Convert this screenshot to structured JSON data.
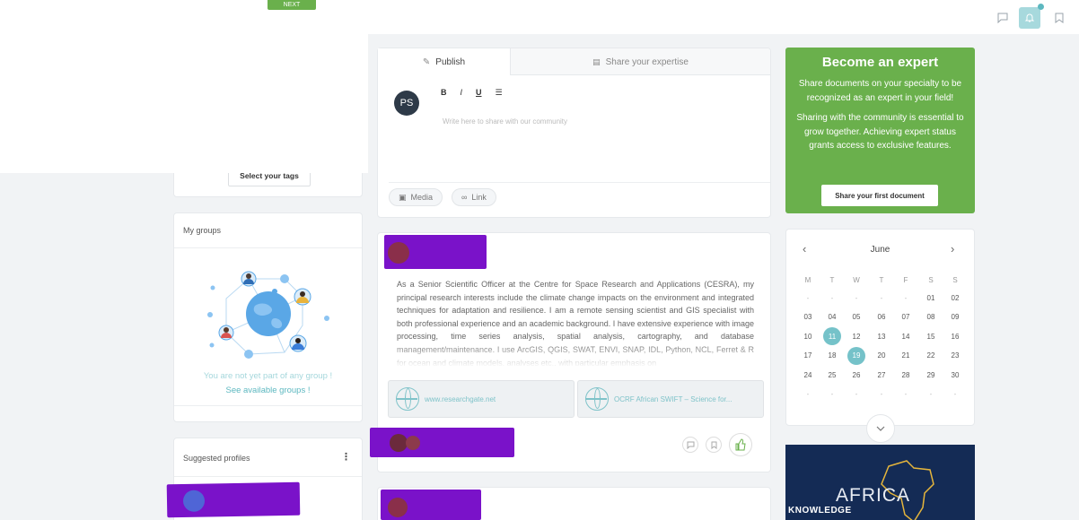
{
  "topbar": {
    "next_label": "NEXT"
  },
  "tags": {
    "button_label": "Select your tags"
  },
  "groups": {
    "title": "My groups",
    "empty_text": "You are not yet part of any group !",
    "link_text": "See available groups !"
  },
  "suggested": {
    "title": "Suggested profiles"
  },
  "composer": {
    "tab_publish": "Publish",
    "tab_expertise": "Share your expertise",
    "avatar_initials": "PS",
    "toolbar": {
      "bold": "B",
      "italic": "I",
      "underline": "U"
    },
    "placeholder": "Write here to share with our community",
    "media_label": "Media",
    "link_label": "Link"
  },
  "post": {
    "body": "As a Senior Scientific Officer at the Centre for Space Research and Applications (CESRA), my principal research interests include the climate change impacts on the environment and integrated techniques for adaptation and resilience. I am a remote sensing scientist and GIS specialist with both professional experience and an academic background. I have extensive experience with image processing, time series analysis, spatial analysis, cartography, and database management/maintenance. I use ArcGIS, QGIS, SWAT, ENVI, SNAP, IDL, Python, NCL, Ferret & R for ocean and climate models, analyses etc., with particular emphasis on",
    "links": [
      {
        "text": "www.researchgate.net"
      },
      {
        "text": "OCRF African SWIFT – Science for..."
      }
    ]
  },
  "expert": {
    "title": "Become an expert",
    "text1": "Share documents on your specialty to be recognized as an expert in your field!",
    "text2": "Sharing with the community is essential to grow together. Achieving expert status grants access to exclusive features.",
    "button": "Share your first document"
  },
  "calendar": {
    "month": "June",
    "weekdays": [
      "M",
      "T",
      "W",
      "T",
      "F",
      "S",
      "S"
    ],
    "rows": [
      [
        "-",
        "-",
        "-",
        "-",
        "-",
        "01",
        "02"
      ],
      [
        "03",
        "04",
        "05",
        "06",
        "07",
        "08",
        "09"
      ],
      [
        "10",
        "11",
        "12",
        "13",
        "14",
        "15",
        "16"
      ],
      [
        "17",
        "18",
        "19",
        "20",
        "21",
        "22",
        "23"
      ],
      [
        "24",
        "25",
        "26",
        "27",
        "28",
        "29",
        "30"
      ],
      [
        "-",
        "-",
        "-",
        "-",
        "-",
        "-",
        "-"
      ]
    ],
    "highlighted": [
      "11",
      "19"
    ]
  },
  "promo": {
    "line1": "AFRICA",
    "line2": "KNOWLEDGE"
  },
  "colors": {
    "accent": "#6ab04c",
    "teal": "#5db8c0",
    "redaction": "#7a12c9"
  }
}
